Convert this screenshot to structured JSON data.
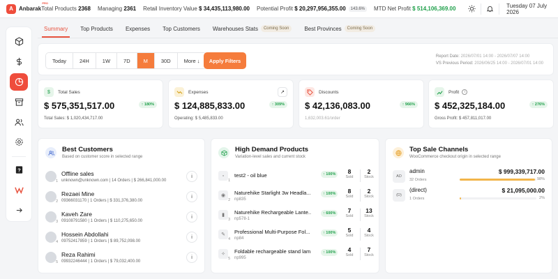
{
  "app": {
    "name": "Anbarak",
    "badge": "PRO",
    "logo_letter": "A"
  },
  "topbar": {
    "total_products_label": "Total Products",
    "total_products": "2368",
    "managing_label": "Managing",
    "managing": "2361",
    "retail_label": "Retail Inventory Value",
    "retail_value": "$ 34,435,113,980.00",
    "potential_label": "Potential Profit",
    "potential_value": "$ 20,297,956,355.00",
    "potential_pct": "143.6%",
    "mtd_label": "MTD Net Profit",
    "mtd_value": "$ 514,106,369.00",
    "date": "Tuesday 07 July 2026"
  },
  "sidebar": {
    "items": [
      "box-icon",
      "dollar-icon",
      "pie-chart-icon",
      "archive-icon",
      "users-icon",
      "gear-icon",
      "help-icon",
      "brand-icon",
      "arrow-right-icon"
    ],
    "active": 2
  },
  "tabs": [
    {
      "label": "Summary",
      "active": true
    },
    {
      "label": "Top Products"
    },
    {
      "label": "Expenses"
    },
    {
      "label": "Top Customers"
    },
    {
      "label": "Warehouses Stats",
      "soon": "Coming Soon"
    },
    {
      "label": "Best Provinces",
      "soon": "Coming Soon"
    }
  ],
  "filters": {
    "ranges": [
      "Today",
      "24H",
      "1W",
      "7D",
      "M",
      "30D",
      "More ↓"
    ],
    "active_range": "M",
    "apply_label": "Apply Filters",
    "report_label": "Report Date:",
    "report_value": "2026/07/01 14:00 - 2026/07/07 14:00",
    "previous_label": "VS Previous Period:",
    "previous_value": "2026/06/25 14:00 - 2026/07/01 14:00"
  },
  "kpis": [
    {
      "label": "Total Sales",
      "value": "$ 575,351,517.00",
      "badge": "↑ 180%",
      "sub": "Total Sales: $ 1,020,434,717.00",
      "color": "#20a04b",
      "bg": "#e6f5ea",
      "icon": "dollar-icon"
    },
    {
      "label": "Expenses",
      "value": "$ 124,885,833.00",
      "badge": "↑ 309%",
      "sub": "Operating: $ 5,485,833.00",
      "color": "#d4a017",
      "bg": "#fbf1d6",
      "icon": "trend-icon"
    },
    {
      "label": "Discounts",
      "value": "$ 42,136,083.00",
      "badge": "↑ 966%",
      "sub": "1,632,003.61/order",
      "color": "#e8533f",
      "bg": "#fde7e3",
      "icon": "tag-icon"
    },
    {
      "label": "Profit",
      "value": "$ 452,325,184.00",
      "badge": "↑ 276%",
      "sub": "Gross Profit: $ 457,811,017.00",
      "color": "#20a04b",
      "bg": "#e6f5ea",
      "icon": "chart-icon"
    }
  ],
  "customers": {
    "title": "Best Customers",
    "subtitle": "Based on customer score in selected range",
    "rows": [
      {
        "rank": "1",
        "name": "Offline sales",
        "contact": "unknown@unknown.com",
        "orders": "14 Orders",
        "amount": "$ 266,841,000.00"
      },
      {
        "rank": "2",
        "name": "Rezaei Mine",
        "contact": "09366031170",
        "orders": "1 Orders",
        "amount": "$ 331,376,380.00"
      },
      {
        "rank": "3",
        "name": "Kaveh Zare",
        "contact": "09108791580",
        "orders": "1 Orders",
        "amount": "$ 110,275,650.00"
      },
      {
        "rank": "4",
        "name": "Hossein Abdollahi",
        "contact": "09752417859",
        "orders": "1 Orders",
        "amount": "$ 89,752,098.00"
      },
      {
        "rank": "5",
        "name": "Reza Rahimi",
        "contact": "09932246444",
        "orders": "1 Orders",
        "amount": "$ 79,032,400.00"
      }
    ]
  },
  "products": {
    "title": "High Demand Products",
    "subtitle": "Variation-level sales and current stock",
    "sold_label": "Sold",
    "stock_label": "Stock",
    "rows": [
      {
        "rank": "1",
        "name": "test2 - oil blue",
        "sku": "",
        "badge": "↑ 100%",
        "sold": "8",
        "stock": "2"
      },
      {
        "rank": "2",
        "name": "Naturehike Starlight 3w Headla...",
        "sku": "np835",
        "badge": "↑ 100%",
        "sold": "8",
        "stock": "2"
      },
      {
        "rank": "3",
        "name": "Naturehike Rechargeable Lante...",
        "sku": "np578-1",
        "badge": "↑ 600%",
        "sold": "7",
        "stock": "13"
      },
      {
        "rank": "4",
        "name": "Professional Multi-Purpose Fol...",
        "sku": "np84",
        "badge": "↑ 100%",
        "sold": "5",
        "stock": "4"
      },
      {
        "rank": "5",
        "name": "Foldable rechargeable stand lam...",
        "sku": "np995",
        "badge": "↑ 100%",
        "sold": "4",
        "stock": "7"
      }
    ]
  },
  "channels": {
    "title": "Top Sale Channels",
    "subtitle": "WooCommerce checkout origin in selected range",
    "rows": [
      {
        "code": "AD",
        "name": "admin",
        "value": "$ 999,339,717.00",
        "orders": "32 Orders",
        "pct": "98%",
        "share": 0.98
      },
      {
        "code": "(D)",
        "name": "(direct)",
        "value": "$ 21,095,000.00",
        "orders": "1 Orders",
        "pct": "2%",
        "share": 0.02
      }
    ]
  }
}
